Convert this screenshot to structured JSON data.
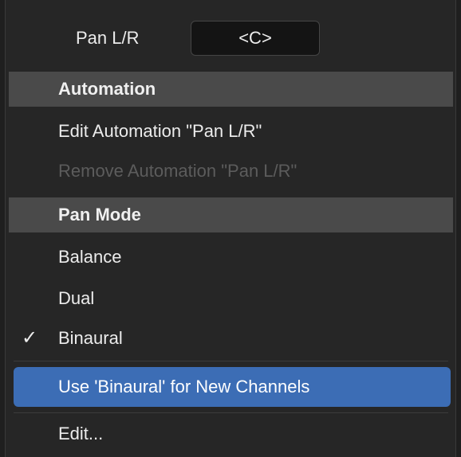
{
  "pan_control": {
    "label": "Pan L/R",
    "value": "<C>"
  },
  "sections": {
    "automation": {
      "header": "Automation",
      "items": [
        {
          "label": "Edit Automation \"Pan L/R\"",
          "enabled": true
        },
        {
          "label": "Remove Automation \"Pan L/R\"",
          "enabled": false
        }
      ]
    },
    "pan_mode": {
      "header": "Pan Mode",
      "items": [
        {
          "label": "Balance",
          "checked": false
        },
        {
          "label": "Dual",
          "checked": false
        },
        {
          "label": "Binaural",
          "checked": true
        }
      ]
    }
  },
  "checkmark_glyph": "✓",
  "actions": {
    "use_default": "Use 'Binaural' for New Channels",
    "edit": "Edit..."
  },
  "colors": {
    "background": "#262626",
    "header_bg": "#4a4a4a",
    "highlight": "#3c6db5",
    "text": "#ececec",
    "disabled_text": "#5c5c5c"
  }
}
